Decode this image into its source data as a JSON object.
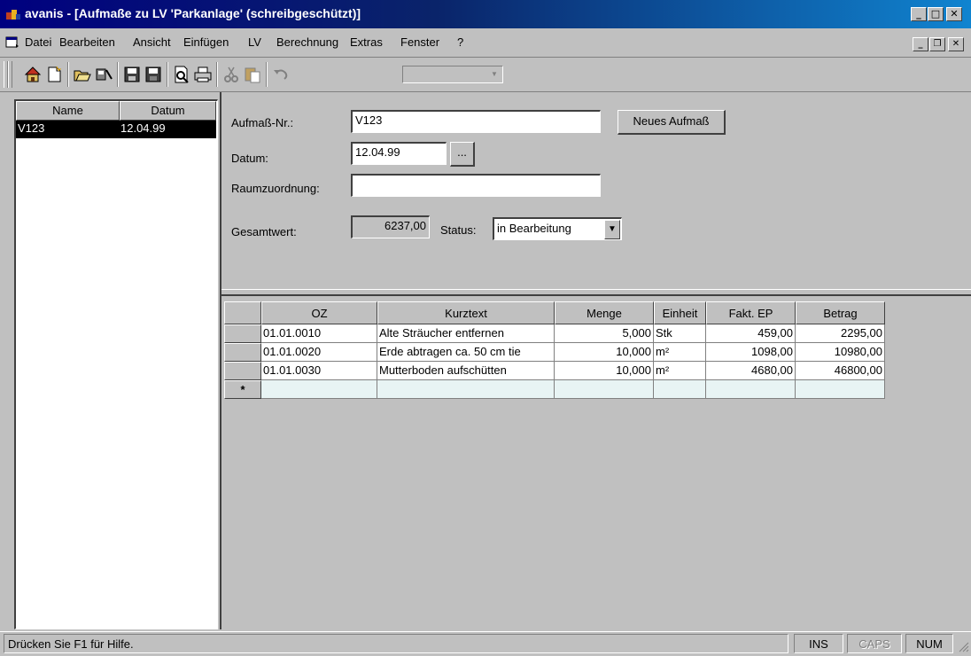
{
  "window": {
    "title": "avanis - [Aufmaße zu LV 'Parkanlage' (schreibgeschützt)]",
    "app_icon": "app-icon"
  },
  "menu": {
    "items": [
      "Datei",
      "Bearbeiten",
      "Ansicht",
      "Einfügen",
      "LV",
      "Berechnung",
      "Extras",
      "Fenster",
      "?"
    ]
  },
  "toolbar": {
    "buttons": [
      "home-icon",
      "new-document-icon",
      "open-folder-icon",
      "tools-icon",
      "save-icon",
      "save-all-icon",
      "print-preview-icon",
      "print-icon",
      "cut-icon",
      "paste-icon",
      "undo-icon"
    ],
    "combo_value": ""
  },
  "list": {
    "columns": [
      "Name",
      "Datum"
    ],
    "rows": [
      {
        "name": "V123",
        "datum": "12.04.99"
      }
    ]
  },
  "form": {
    "aufmass_label": "Aufmaß-Nr.:",
    "aufmass_value": "V123",
    "neues_button": "Neues Aufmaß",
    "datum_label": "Datum:",
    "datum_value": "12.04.99",
    "datum_button": "...",
    "raum_label": "Raumzuordnung:",
    "raum_value": "",
    "gesamt_label": "Gesamtwert:",
    "gesamt_value": "6237,00",
    "status_label": "Status:",
    "status_value": "in Bearbeitung"
  },
  "grid": {
    "columns": [
      "OZ",
      "Kurztext",
      "Menge",
      "Einheit",
      "Fakt. EP",
      "Betrag"
    ],
    "rows": [
      {
        "oz": "01.01.0010",
        "kurztext": "Alte Sträucher entfernen",
        "menge": "5,000",
        "einheit": "Stk",
        "ep": "459,00",
        "betrag": "2295,00"
      },
      {
        "oz": "01.01.0020",
        "kurztext": "Erde abtragen ca. 50 cm tie",
        "menge": "10,000",
        "einheit": "m²",
        "ep": "1098,00",
        "betrag": "10980,00"
      },
      {
        "oz": "01.01.0030",
        "kurztext": "Mutterboden aufschütten",
        "menge": "10,000",
        "einheit": "m²",
        "ep": "4680,00",
        "betrag": "46800,00"
      }
    ],
    "new_row_marker": "*"
  },
  "statusbar": {
    "hint": "Drücken Sie F1 für Hilfe.",
    "ins": "INS",
    "caps": "CAPS",
    "num": "NUM"
  }
}
